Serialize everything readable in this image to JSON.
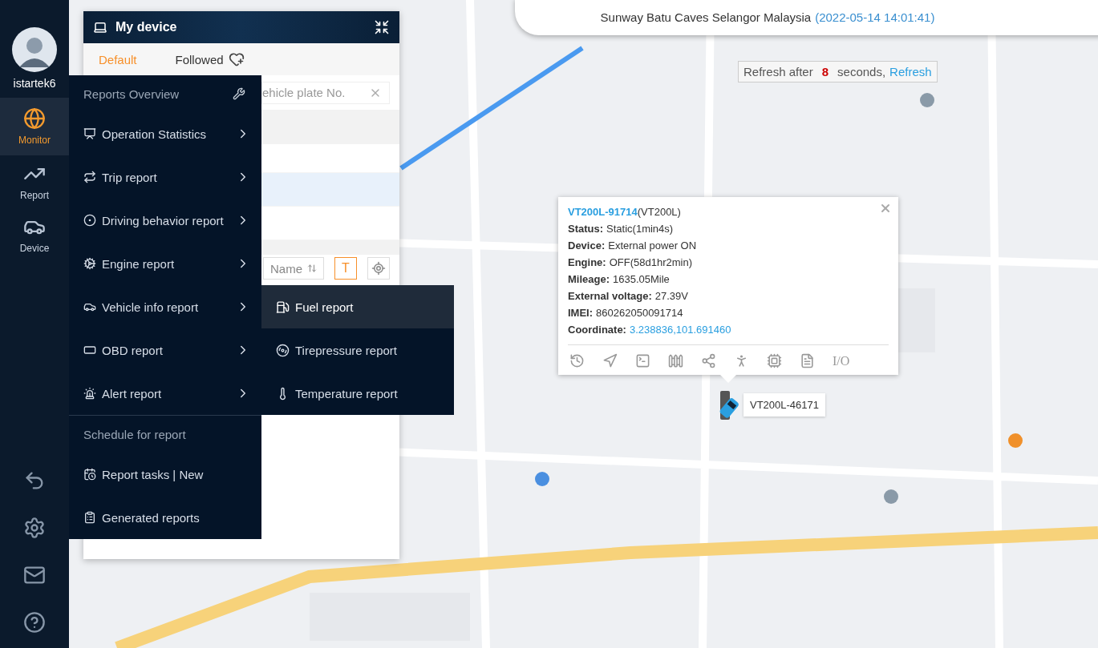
{
  "sidebar": {
    "user": {
      "name": "istartek6"
    },
    "items": [
      {
        "label": "Monitor",
        "selected": true
      },
      {
        "label": "Report",
        "selected": false
      },
      {
        "label": "Device",
        "selected": false
      }
    ]
  },
  "device_panel": {
    "title": "My device",
    "tabs": [
      {
        "label": "Default",
        "selected": true
      },
      {
        "label": "Followed",
        "selected": false
      }
    ],
    "search": {
      "placeholder": "ehicle plate No."
    },
    "rows": [
      {
        "selected": false
      },
      {
        "selected": true
      },
      {
        "selected": false
      }
    ],
    "toolbar": {
      "sort_button": "Name",
      "text_button": {
        "label": "T",
        "active": true
      }
    }
  },
  "reports_menu": {
    "sections": [
      {
        "title": "Reports Overview",
        "items": [
          {
            "label": "Operation Statistics",
            "has_submenu": true
          },
          {
            "label": "Trip report",
            "has_submenu": true
          },
          {
            "label": "Driving behavior report",
            "has_submenu": true
          },
          {
            "label": "Engine report",
            "has_submenu": true
          },
          {
            "label": "Vehicle info report",
            "has_submenu": true
          },
          {
            "label": "OBD report",
            "has_submenu": true
          },
          {
            "label": "Alert report",
            "has_submenu": true
          }
        ]
      },
      {
        "title": "Schedule for report",
        "items": [
          {
            "label": "Report tasks | New",
            "has_submenu": false
          },
          {
            "label": "Generated reports",
            "has_submenu": false
          }
        ]
      }
    ]
  },
  "submenu": {
    "items": [
      {
        "label": "Fuel report",
        "selected": true
      },
      {
        "label": "Tirepressure report",
        "selected": false
      },
      {
        "label": "Temperature report",
        "selected": false
      }
    ]
  },
  "address_bar": {
    "address": "Sunway Batu Caves Selangor Malaysia",
    "time": "(2022-05-14 14:01:41)"
  },
  "refresh_notice": {
    "prefix": "Refresh after",
    "count": "8",
    "suffix": "seconds,",
    "link": "Refresh"
  },
  "info_popup": {
    "name": "VT200L-91714",
    "model": "(VT200L)",
    "fields": [
      {
        "label": "Status:",
        "value": "Static(1min4s)",
        "kind": "text"
      },
      {
        "label": "Device:",
        "value": "External power ON",
        "kind": "text"
      },
      {
        "label": "Engine:",
        "value": "OFF(58d1hr2min)",
        "kind": "text"
      },
      {
        "label": "Mileage:",
        "value": "1635.05Mile",
        "kind": "text"
      },
      {
        "label": "External voltage:",
        "value": "27.39V",
        "kind": "text"
      },
      {
        "label": "IMEI:",
        "value": "860262050091714",
        "kind": "text"
      },
      {
        "label": "Coordinate:",
        "value": "3.238836,101.691460",
        "kind": "link"
      }
    ],
    "io_button": "I/O"
  },
  "marker": {
    "label": "VT200L-46171"
  }
}
